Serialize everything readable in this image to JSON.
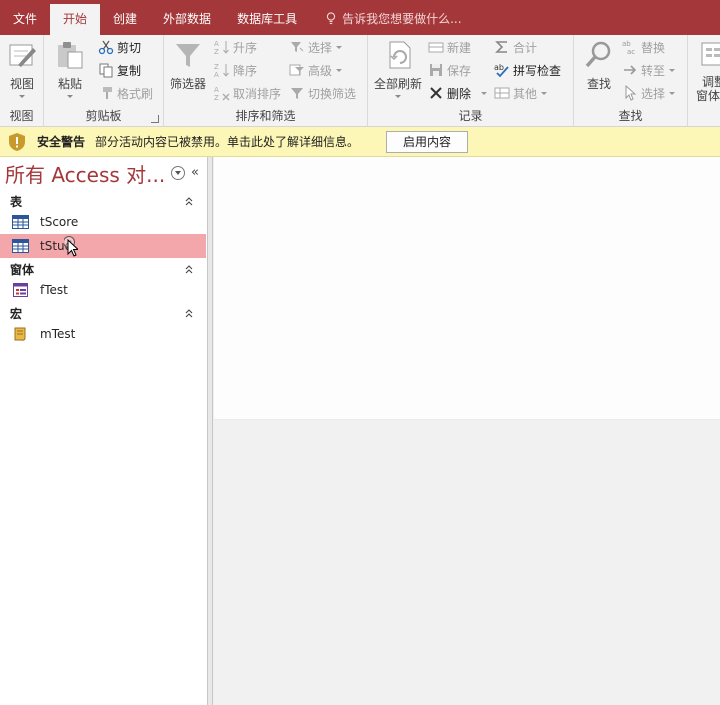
{
  "tabs": [
    {
      "label": "文件",
      "active": false
    },
    {
      "label": "开始",
      "active": true
    },
    {
      "label": "创建",
      "active": false
    },
    {
      "label": "外部数据",
      "active": false
    },
    {
      "label": "数据库工具",
      "active": false
    }
  ],
  "tellme": {
    "text": "告诉我您想要做什么..."
  },
  "ribbon": {
    "views": {
      "label": "视图",
      "view_button": "视图"
    },
    "clipboard": {
      "label": "剪贴板",
      "paste": "粘贴",
      "cut": "剪切",
      "copy": "复制",
      "format_painter": "格式刷"
    },
    "sort_filter": {
      "label": "排序和筛选",
      "filter": "筛选器",
      "ascending": "升序",
      "descending": "降序",
      "clear_sort": "取消排序",
      "selection": "选择",
      "advanced": "高级",
      "toggle_filter": "切换筛选"
    },
    "records": {
      "label": "记录",
      "refresh_all": "全部刷新",
      "new": "新建",
      "save": "保存",
      "delete": "删除",
      "totals": "合计",
      "spelling": "拼写检查",
      "more": "其他"
    },
    "find": {
      "label": "查找",
      "find": "查找",
      "replace": "替换",
      "goto": "转至",
      "select": "选择"
    },
    "window": {
      "size_line1": "调整",
      "size_line2": "窗体大"
    }
  },
  "security": {
    "title": "安全警告",
    "message": "部分活动内容已被禁用。单击此处了解详细信息。",
    "enable_button": "启用内容"
  },
  "nav": {
    "title": "所有 Access 对...",
    "sections": [
      {
        "label": "表",
        "items": [
          {
            "label": "tScore"
          },
          {
            "label": "tStud",
            "selected": true
          }
        ]
      },
      {
        "label": "窗体",
        "items": [
          {
            "label": "fTest"
          }
        ]
      },
      {
        "label": "宏",
        "items": [
          {
            "label": "mTest"
          }
        ]
      }
    ]
  },
  "colors": {
    "accent": "#a4373a",
    "selected_item": "#f4a7ab",
    "security_bar": "#fcf7b6"
  }
}
